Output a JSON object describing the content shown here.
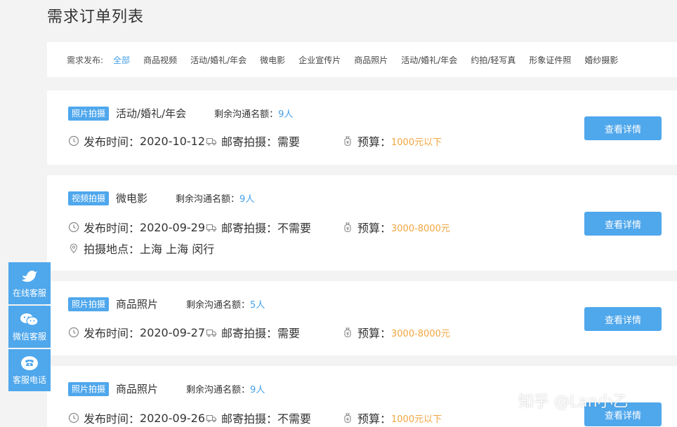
{
  "page": {
    "title": "需求订单列表"
  },
  "filter": {
    "label": "需求发布:",
    "items": [
      "全部",
      "商品视频",
      "活动/婚礼/年会",
      "微电影",
      "企业宣传片",
      "商品照片",
      "活动/婚礼/年会",
      "约拍/轻写真",
      "形象证件照",
      "婚纱摄影"
    ],
    "active_index": 0
  },
  "orders": [
    {
      "tag": "照片拍摄",
      "title": "活动/婚礼/年会",
      "quota_label": "剩余沟通名额：",
      "quota_value": "9人",
      "publish_label": "发布时间：",
      "publish_date": "2020-10-12",
      "mail_label": "邮寄拍摄：",
      "mail_value": "需要",
      "budget_label": "预算：",
      "budget_value": "1000元以下",
      "button": "查看详情"
    },
    {
      "tag": "视频拍摄",
      "title": "微电影",
      "quota_label": "剩余沟通名额：",
      "quota_value": "9人",
      "publish_label": "发布时间：",
      "publish_date": "2020-09-29",
      "mail_label": "邮寄拍摄：",
      "mail_value": "不需要",
      "budget_label": "预算：",
      "budget_value": "3000-8000元",
      "location_label": "拍摄地点：",
      "location_value": "上海 上海 闵行",
      "button": "查看详情"
    },
    {
      "tag": "照片拍摄",
      "title": "商品照片",
      "quota_label": "剩余沟通名额：",
      "quota_value": "5人",
      "publish_label": "发布时间：",
      "publish_date": "2020-09-27",
      "mail_label": "邮寄拍摄：",
      "mail_value": "需要",
      "budget_label": "预算：",
      "budget_value": "3000-8000元",
      "button": "查看详情"
    },
    {
      "tag": "照片拍摄",
      "title": "商品照片",
      "quota_label": "剩余沟通名额：",
      "quota_value": "9人",
      "publish_label": "发布时间：",
      "publish_date": "2020-09-26",
      "mail_label": "邮寄拍摄：",
      "mail_value": "不需要",
      "budget_label": "预算：",
      "budget_value": "1000元以下",
      "button": "查看详情"
    }
  ],
  "side_panel": [
    {
      "label": "在线客服",
      "icon": "bird-icon"
    },
    {
      "label": "微信客服",
      "icon": "wechat-icon"
    },
    {
      "label": "客服电话",
      "icon": "phone-icon"
    }
  ],
  "watermark": "知乎 @Lan小乙",
  "colors": {
    "accent": "#4fa7ec",
    "budget": "#f0a640",
    "background": "#f3f3f3"
  }
}
